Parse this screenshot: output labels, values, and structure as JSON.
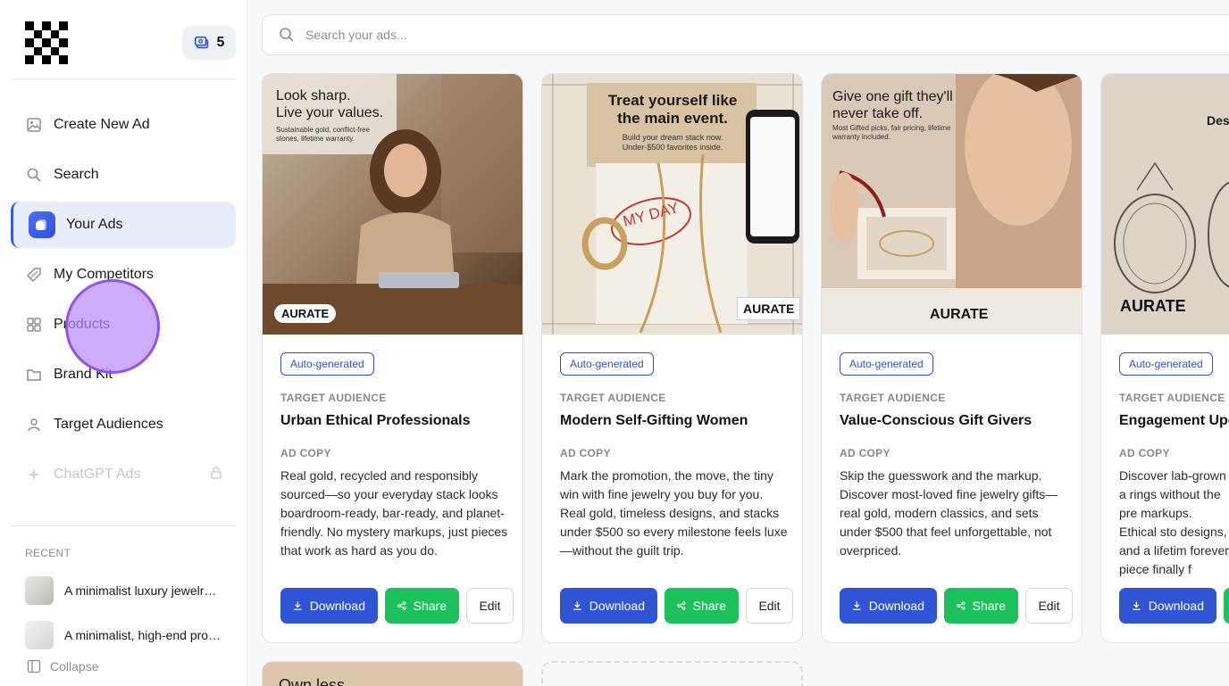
{
  "credits": {
    "count": "5"
  },
  "nav": [
    {
      "label": "Create New Ad",
      "icon": "image-icon"
    },
    {
      "label": "Search",
      "icon": "search-icon"
    },
    {
      "label": "Your Ads",
      "icon": "ads-icon"
    },
    {
      "label": "My Competitors",
      "icon": "tag-icon"
    },
    {
      "label": "Products",
      "icon": "grid-icon"
    },
    {
      "label": "Brand Kit",
      "icon": "folder-icon"
    },
    {
      "label": "Target Audiences",
      "icon": "person-icon"
    },
    {
      "label": "ChatGPT Ads",
      "icon": "sparkle-icon"
    }
  ],
  "recent": {
    "label": "RECENT",
    "items": [
      "A minimalist luxury jewelry ...",
      "A minimalist, high-end prod..."
    ]
  },
  "collapse_label": "Collapse",
  "search": {
    "placeholder": "Search your ads..."
  },
  "common": {
    "badge": "Auto-generated",
    "target_label": "TARGET AUDIENCE",
    "copy_label": "AD COPY",
    "download": "Download",
    "share": "Share",
    "edit": "Edit"
  },
  "cards": [
    {
      "audience": "Urban Ethical Professionals",
      "copy": "Real gold, recycled and responsibly sourced—so your everyday stack looks boardroom-ready, bar-ready, and planet-friendly. No mystery markups, just pieces that work as hard as you do.",
      "headline": "Look sharp.\nLive your values.",
      "sub": "Sustainable gold, conflict-free stones, lifetime warranty.",
      "brand": "AURATE"
    },
    {
      "audience": "Modern Self-Gifting Women",
      "copy": "Mark the promotion, the move, the tiny win with fine jewelry you buy for you. Real gold, timeless designs, and stacks under $500 so every milestone feels luxe—without the guilt trip.",
      "headline": "Treat yourself like the main event.",
      "sub": "Build your dream stack now. Under-$500 favorites inside.",
      "brand": "AURATE",
      "note": "MY DAY"
    },
    {
      "audience": "Value-Conscious Gift Givers",
      "copy": "Skip the guesswork and the markup. Discover most-loved fine jewelry gifts—real gold, modern classics, and sets under $500 that feel unforgettable, not overpriced.",
      "headline": "Give one gift they'll never take off.",
      "sub": "Most Gifted picks, fair pricing, lifetime warranty included.",
      "brand": "AURATE"
    },
    {
      "audience": "Engagement Upg",
      "copy": "Discover lab-grown a rings without the pre markups. Ethical sto designs, and a lifetim forever piece finally f",
      "headline": "Des",
      "brand": "AURATE"
    }
  ],
  "partial_card": {
    "headline": "Own less"
  }
}
